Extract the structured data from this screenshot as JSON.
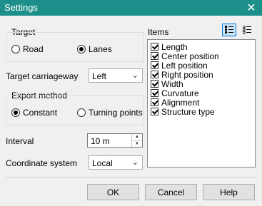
{
  "window": {
    "title": "Settings",
    "close_glyph": "✕"
  },
  "target": {
    "group_label": "Target",
    "options": [
      {
        "label": "Road",
        "checked": false
      },
      {
        "label": "Lanes",
        "checked": true
      }
    ]
  },
  "target_carriageway": {
    "label": "Target carriageway",
    "value": "Left"
  },
  "export_method": {
    "group_label": "Export method",
    "options": [
      {
        "label": "Constant",
        "checked": true
      },
      {
        "label": "Turning points",
        "checked": false
      }
    ]
  },
  "interval": {
    "label": "Interval",
    "value": "10 m"
  },
  "coordinate_system": {
    "label": "Coordinate system",
    "value": "Local"
  },
  "items": {
    "label": "Items",
    "list": [
      {
        "label": "Length",
        "checked": true
      },
      {
        "label": "Center position",
        "checked": true
      },
      {
        "label": "Left position",
        "checked": true
      },
      {
        "label": "Right position",
        "checked": true
      },
      {
        "label": "Width",
        "checked": true
      },
      {
        "label": "Curvature",
        "checked": true
      },
      {
        "label": "Alignment",
        "checked": true
      },
      {
        "label": "Structure type",
        "checked": true
      }
    ],
    "toolbar": [
      {
        "icon": "check-all-icon",
        "active": true
      },
      {
        "icon": "uncheck-all-icon",
        "active": false
      }
    ]
  },
  "buttons": {
    "ok": "OK",
    "cancel": "Cancel",
    "help": "Help"
  },
  "colors": {
    "titlebar": "#1d8f8a",
    "accent": "#0078d7"
  }
}
